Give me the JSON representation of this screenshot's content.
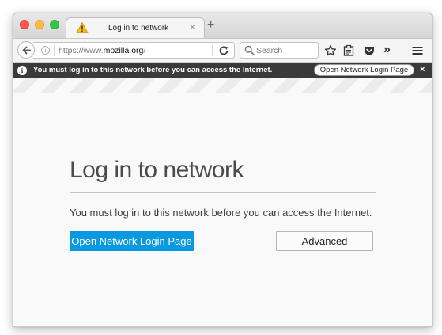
{
  "tab": {
    "title": "Log in to network",
    "close_glyph": "×",
    "icon": "warning-icon"
  },
  "toolbar": {
    "new_tab_glyph": "+",
    "url_prefix": "https://www.",
    "url_domain": "mozilla.org",
    "url_suffix": "/",
    "search_placeholder": "Search",
    "overflow_glyph": "»",
    "icons": [
      "back-arrow-icon",
      "info-icon",
      "reload-icon",
      "search-icon",
      "bookmark-star-icon",
      "reader-view-icon",
      "pocket-icon",
      "overflow-chevron-icon",
      "hamburger-menu-icon"
    ]
  },
  "notification": {
    "info_glyph": "i",
    "message": "You must log in to this network before you can access the Internet.",
    "button_label": "Open Network Login Page",
    "close_glyph": "×"
  },
  "page": {
    "title": "Log in to network",
    "description": "You must log in to this network before you can access the Internet.",
    "primary_button": "Open Network Login Page",
    "secondary_button": "Advanced"
  },
  "colors": {
    "primary_button": "#0a99e1",
    "notification_bar": "#3a3a3a",
    "warning": "#ffbf00"
  }
}
